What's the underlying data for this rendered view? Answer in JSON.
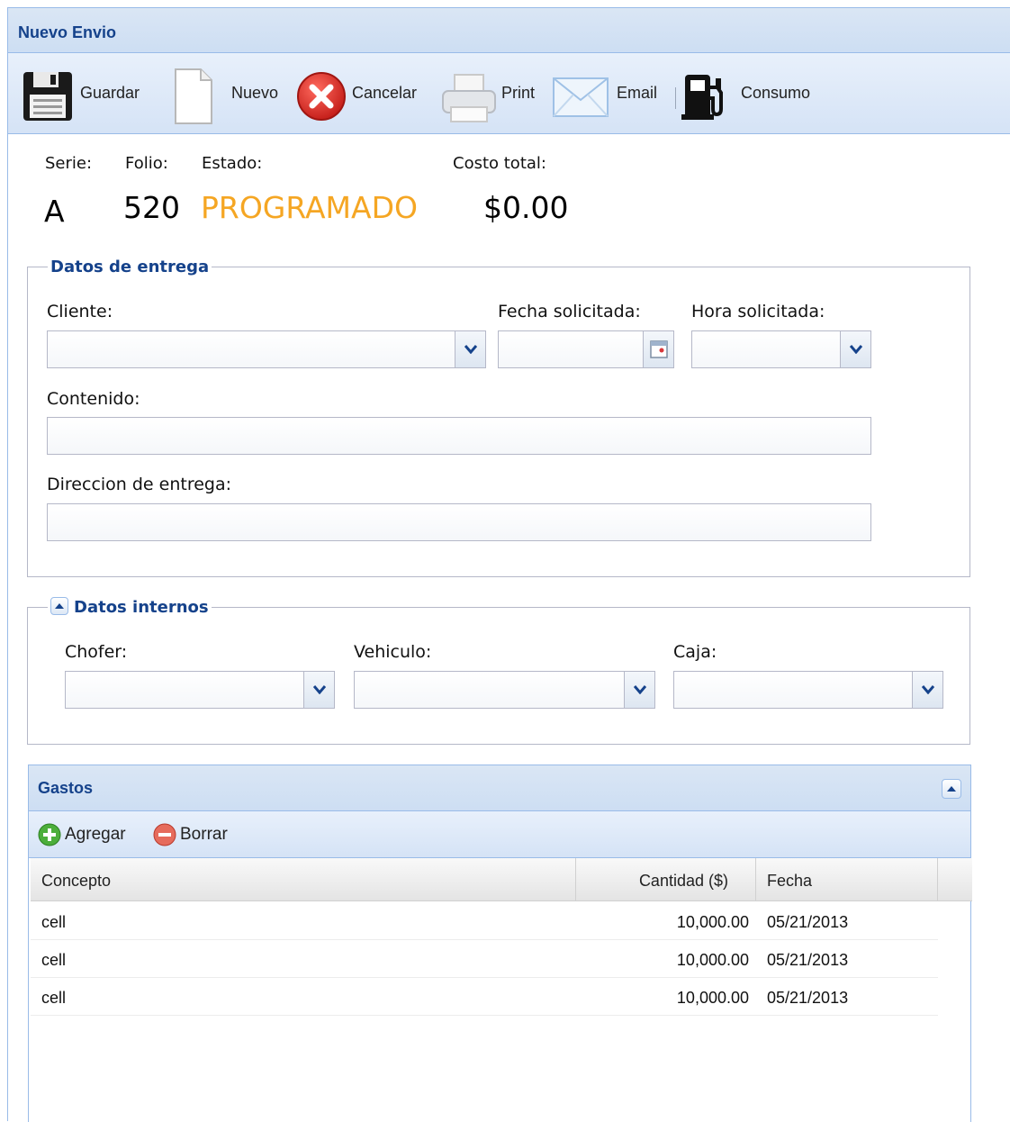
{
  "window": {
    "title": "Nuevo Envio"
  },
  "toolbar": {
    "guardar": "Guardar",
    "nuevo": "Nuevo",
    "cancelar": "Cancelar",
    "print": "Print",
    "email": "Email",
    "consumo": "Consumo",
    "icons": [
      "floppy-disk-icon",
      "new-document-icon",
      "cancel-icon",
      "printer-icon",
      "envelope-icon",
      "fuel-pump-icon"
    ]
  },
  "summary": {
    "serie_label": "Serie:",
    "folio_label": "Folio:",
    "estado_label": "Estado:",
    "costo_label": "Costo total:",
    "serie": "A",
    "folio": "520",
    "estado": "PROGRAMADO",
    "costo": "$0.00",
    "estado_color": "#f5a623"
  },
  "entrega": {
    "legend": "Datos de entrega",
    "cliente_label": "Cliente:",
    "cliente_value": "",
    "fecha_label": "Fecha solicitada:",
    "fecha_value": "",
    "hora_label": "Hora solicitada:",
    "hora_value": "",
    "contenido_label": "Contenido:",
    "contenido_value": "",
    "direccion_label": "Direccion de entrega:",
    "direccion_value": ""
  },
  "internos": {
    "legend": "Datos internos",
    "chofer_label": "Chofer:",
    "vehiculo_label": "Vehiculo:",
    "caja_label": "Caja:"
  },
  "gastos": {
    "title": "Gastos",
    "agregar": "Agregar",
    "borrar": "Borrar",
    "columns": [
      "Concepto",
      "Cantidad ($)",
      "Fecha"
    ],
    "rows": [
      [
        "cell",
        "10,000.00",
        "05/21/2013"
      ],
      [
        "cell",
        "10,000.00",
        "05/21/2013"
      ],
      [
        "cell",
        "10,000.00",
        "05/21/2013"
      ]
    ]
  },
  "colors": {
    "header_text": "#15428b",
    "border": "#99bbe8",
    "accent_orange": "#f5a623"
  }
}
